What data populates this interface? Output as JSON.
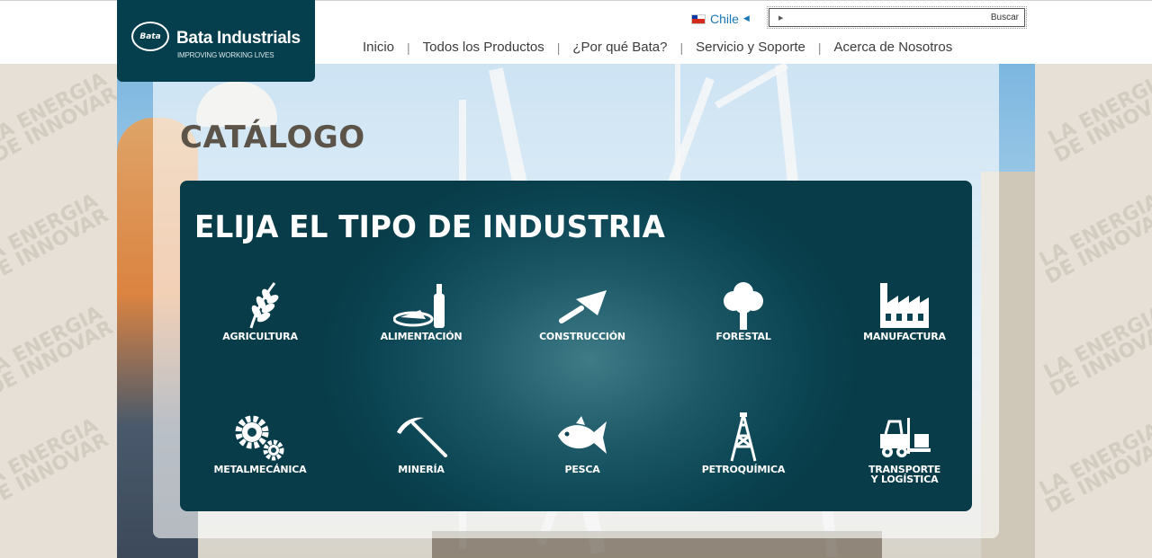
{
  "header": {
    "logo": {
      "brand": "Bata Industrials",
      "tagline": "IMPROVING WORKING LIVES",
      "badge": "Bata"
    },
    "country": {
      "name": "Chile",
      "flag_icon": "chile-flag-icon",
      "arrow_icon": "triangle-left-icon"
    },
    "search": {
      "value": "",
      "placeholder": "",
      "button_label": "Buscar"
    },
    "nav": [
      {
        "label": "Inicio"
      },
      {
        "label": "Todos los Productos"
      },
      {
        "label": "¿Por qué Bata?"
      },
      {
        "label": "Servicio y Soporte"
      },
      {
        "label": "Acerca de Nosotros"
      }
    ]
  },
  "background": {
    "watermark_line1": "LA ENERGIA",
    "watermark_line2": "DE INNOVAR"
  },
  "main": {
    "title": "CATÁLOGO",
    "industry_box": {
      "title": "ELIJA EL TIPO DE INDUSTRIA",
      "industries": [
        {
          "label": "AGRICULTURA",
          "icon": "wheat-icon"
        },
        {
          "label": "ALIMENTACIÓN",
          "icon": "food-bottle-icon"
        },
        {
          "label": "CONSTRUCCIÓN",
          "icon": "trowel-icon"
        },
        {
          "label": "FORESTAL",
          "icon": "tree-icon"
        },
        {
          "label": "MANUFACTURA",
          "icon": "factory-icon"
        },
        {
          "label": "METALMECÁNICA",
          "icon": "gears-icon"
        },
        {
          "label": "MINERÍA",
          "icon": "pickaxe-icon"
        },
        {
          "label": "PESCA",
          "icon": "fish-icon"
        },
        {
          "label": "PETROQUÍMICA",
          "icon": "oil-derrick-icon"
        },
        {
          "label": "TRANSPORTE Y LOGÍSTICA",
          "icon": "forklift-icon"
        }
      ]
    }
  },
  "colors": {
    "brand_dark_teal": "#053f4d",
    "title_brown": "#5c5349",
    "link_blue": "#1a78b6"
  }
}
